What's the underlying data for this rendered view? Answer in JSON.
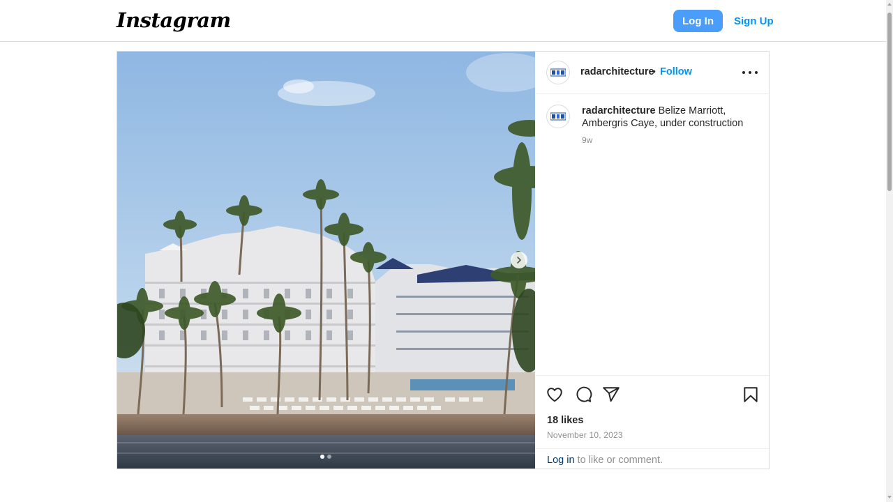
{
  "header": {
    "logo_text": "Instagram",
    "login_label": "Log In",
    "signup_label": "Sign Up"
  },
  "post": {
    "username": "radarchitecture",
    "follow_label": "Follow",
    "bullet": "•",
    "caption_user": "radarchitecture",
    "caption_text": "Belize Marriott, Ambergris Caye, under construction",
    "caption_time": "9w",
    "likes": "18 likes",
    "date": "November 10, 2023",
    "login_link": "Log in",
    "login_suffix": " to like or comment.",
    "carousel": {
      "current": 1,
      "total": 2
    }
  },
  "colors": {
    "primary_button": "#4a9df8",
    "link_blue": "#0095f6",
    "text": "#262626",
    "muted": "#8e8e8e",
    "border": "#dbdbdb"
  },
  "icons": [
    "more-options-icon",
    "heart-icon",
    "comment-icon",
    "share-icon",
    "bookmark-icon",
    "chevron-right-icon"
  ]
}
